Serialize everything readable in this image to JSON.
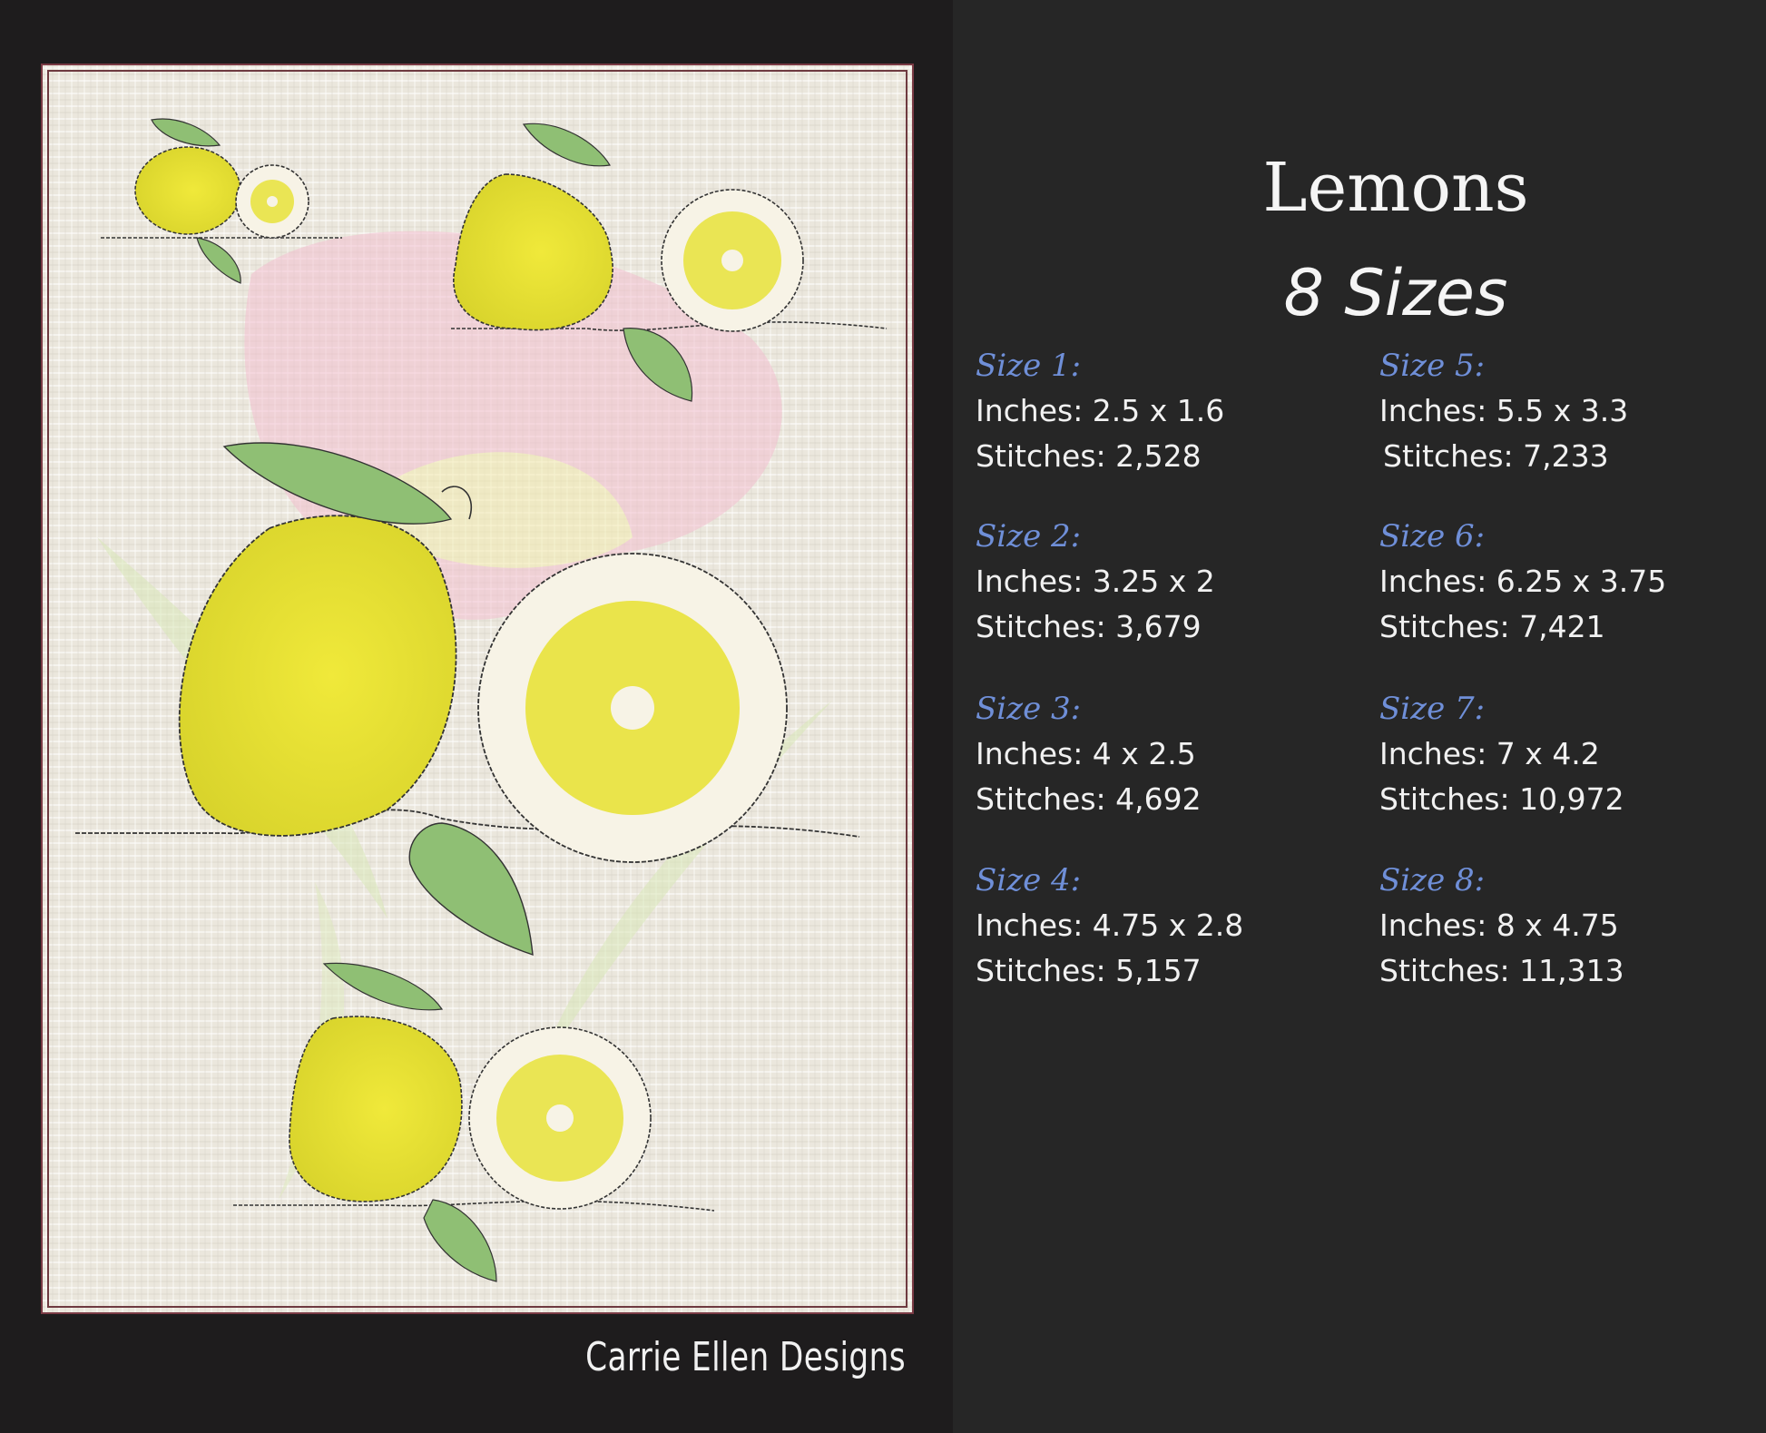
{
  "brand": "Carrie Ellen Designs",
  "title": "Lemons",
  "subtitle": "8 Sizes",
  "colors": {
    "background": "#262626",
    "label_blue": "#6f8fd8",
    "lemon_yellow": "#e8e23a",
    "leaf_green": "#7fb06a",
    "fabric": "#ece8df"
  },
  "sizes": [
    {
      "label": "Size 1:",
      "inches": "Inches: 2.5 x 1.6",
      "stitches": "Stitches: 2,528"
    },
    {
      "label": "Size 2:",
      "inches": "Inches: 3.25 x 2",
      "stitches": "Stitches: 3,679"
    },
    {
      "label": "Size 3:",
      "inches": "Inches: 4 x 2.5",
      "stitches": "Stitches: 4,692"
    },
    {
      "label": "Size 4:",
      "inches": "Inches: 4.75 x 2.8",
      "stitches": "Stitches: 5,157"
    },
    {
      "label": "Size 5:",
      "inches": "Inches: 5.5 x 3.3",
      "stitches": "Stitches: 7,233"
    },
    {
      "label": "Size 6:",
      "inches": "Inches: 6.25 x 3.75",
      "stitches": "Stitches: 7,421"
    },
    {
      "label": "Size 7:",
      "inches": "Inches: 7 x 4.2",
      "stitches": "Stitches: 10,972"
    },
    {
      "label": "Size 8:",
      "inches": "Inches: 8 x 4.75",
      "stitches": "Stitches: 11,313"
    }
  ]
}
